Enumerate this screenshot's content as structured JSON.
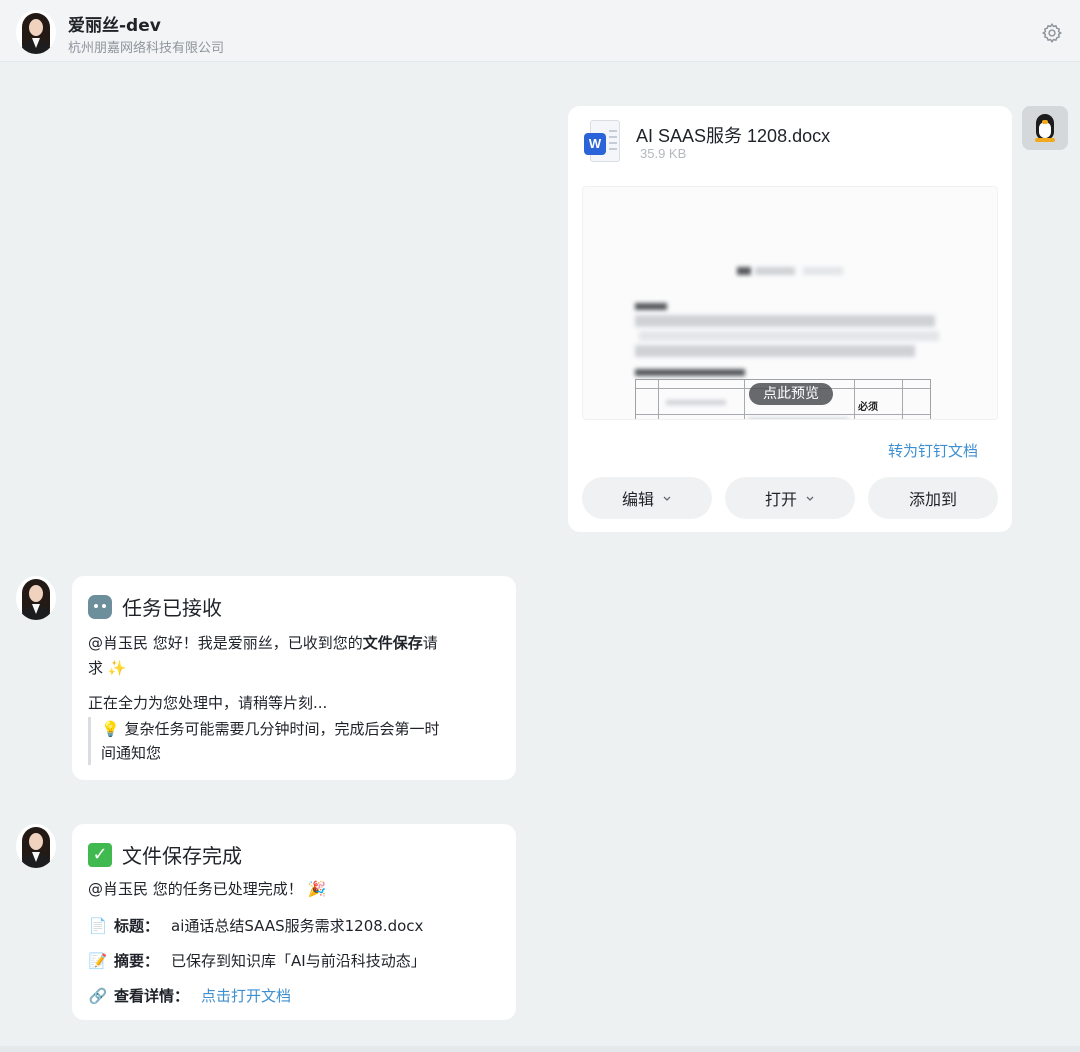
{
  "header": {
    "title": "爱丽丝-dev",
    "subtitle": "杭州朋嘉网络科技有限公司",
    "settings_icon": "gear-icon"
  },
  "file_card": {
    "file_name": "AI SAAS服务 1208.docx",
    "file_size": "35.9 KB",
    "file_icon": "word-doc-icon",
    "preview": {
      "hint": "点此预览",
      "required_cell": "必须"
    },
    "convert_link": "转为钉钉文档",
    "actions": {
      "edit": "编辑",
      "open": "打开",
      "add_to": "添加到"
    }
  },
  "msg_received": {
    "title": "任务已接收",
    "line1_pre": "@肖玉民 您好！我是爱丽丝，已收到您的",
    "line1_bold": "文件保存",
    "line1_post": "请",
    "line2": "求",
    "line3": "正在全力为您处理中，请稍等片刻...",
    "quote_l1": "复杂任务可能需要几分钟时间，完成后会第一时",
    "quote_l2": "间通知您"
  },
  "msg_done": {
    "title": "文件保存完成",
    "line1": "@肖玉民 您的任务已处理完成！",
    "title_label": "标题：",
    "title_value": "ai通话总结SAAS服务需求1208.docx",
    "summary_label": "摘要：",
    "summary_value": "已保存到知识库「AI与前沿科技动态」",
    "details_label": "查看详情：",
    "details_link": "点击打开文档"
  },
  "colors": {
    "background": "#eef1f2",
    "link": "#3d8fd1",
    "word_blue": "#2b63d9"
  }
}
